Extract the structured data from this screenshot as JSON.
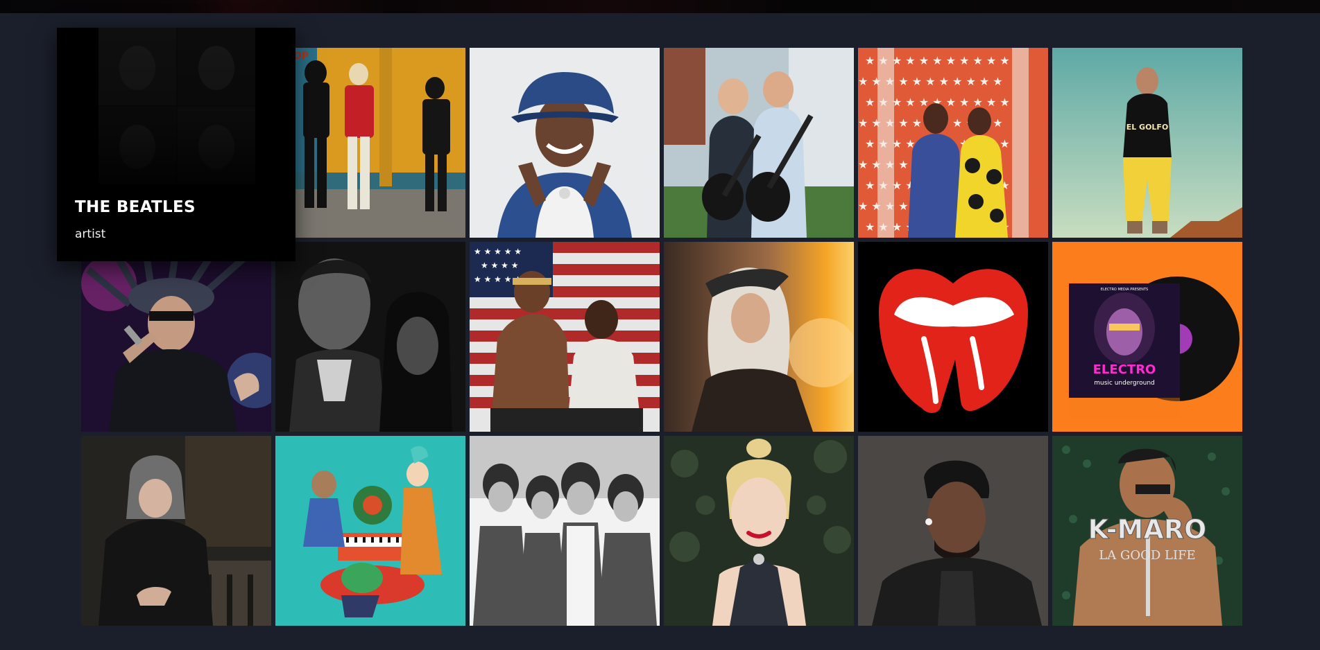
{
  "featured": {
    "title": "THE BEATLES",
    "subtitle": "artist"
  },
  "tiles": [
    {
      "id": "the-beatles",
      "icon": "artist-photo"
    },
    {
      "id": "punk-band",
      "icon": "artist-photo"
    },
    {
      "id": "snoop-dogg",
      "icon": "artist-photo"
    },
    {
      "id": "guitar-duo",
      "icon": "artist-photo"
    },
    {
      "id": "couple-stars",
      "icon": "artist-photo"
    },
    {
      "id": "el-golfo",
      "icon": "artist-photo",
      "shirt_text": "EL GOLFO"
    },
    {
      "id": "jamiroquai",
      "icon": "artist-photo"
    },
    {
      "id": "bw-duo",
      "icon": "artist-photo"
    },
    {
      "id": "outkast",
      "icon": "artist-photo"
    },
    {
      "id": "blonde-singer",
      "icon": "artist-photo"
    },
    {
      "id": "rolling-stones",
      "icon": "tongue-logo"
    },
    {
      "id": "electro",
      "icon": "album-cover",
      "header": "ELECTRO MEDIA PRESENTS",
      "title": "ELECTRO",
      "subtitle": "music underground"
    },
    {
      "id": "eminem",
      "icon": "artist-photo"
    },
    {
      "id": "gorillaz",
      "icon": "artist-photo"
    },
    {
      "id": "bw-band",
      "icon": "artist-photo"
    },
    {
      "id": "gwen-stefani",
      "icon": "artist-photo"
    },
    {
      "id": "usher",
      "icon": "artist-photo"
    },
    {
      "id": "k-maro",
      "icon": "album-cover",
      "title": "K-MARO",
      "subtitle": "LA GOOD LIFE"
    }
  ],
  "colors": {
    "background": "#1b1f2b",
    "featured_bg": "#000000"
  }
}
